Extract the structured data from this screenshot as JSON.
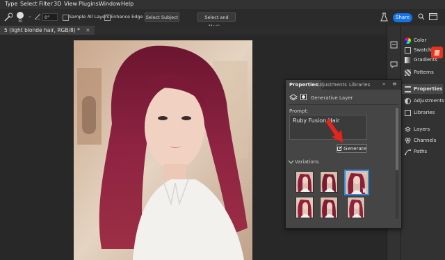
{
  "menu": [
    "Type",
    "Select",
    "Filter",
    "3D",
    "View",
    "Plugins",
    "Window",
    "Help"
  ],
  "options": {
    "brush_size": "30",
    "angle": "0°",
    "sample_all_layers": "Sample All Layers",
    "enhance_edge": "Enhance Edge",
    "select_subject": "Select Subject",
    "select_and_mask": "Select and Mask...",
    "share": "Share"
  },
  "doc_tab": "5 (light blonde hair, RGB/8) *",
  "right_panels": {
    "group1": [
      "Color",
      "Swatches",
      "Gradients",
      "Patterns"
    ],
    "group2": [
      "Properties",
      "Adjustments",
      "Libraries"
    ],
    "group3": [
      "Layers",
      "Channels",
      "Paths"
    ]
  },
  "properties": {
    "tabs": [
      "Properties",
      "Adjustments",
      "Libraries"
    ],
    "layer_type": "Generative Layer",
    "prompt_label": "Prompt:",
    "prompt_value": "Ruby Fusion Hair",
    "generate_label": "Generate",
    "variations_label": "Variations"
  },
  "colors": {
    "accent": "#2d8ceb",
    "share": "#1473e6",
    "arrow": "#e8231c",
    "hair": "#8a1f3c"
  }
}
